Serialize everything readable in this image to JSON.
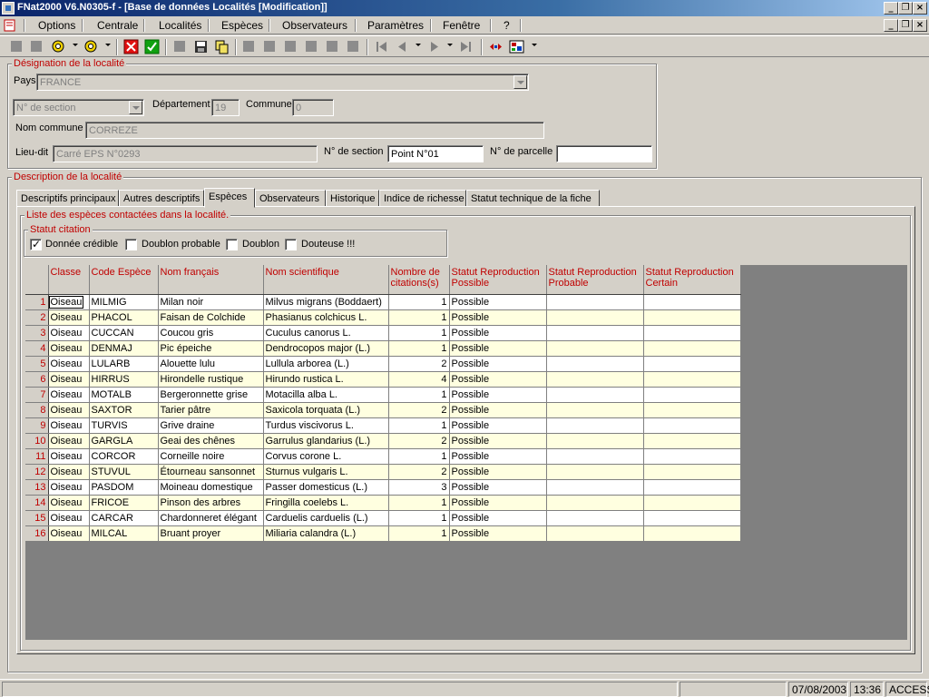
{
  "window": {
    "title": "FNat2000 V6.N0305-f - [Base de données Localités [Modification]]"
  },
  "menu": [
    "Options",
    "Centrale",
    "Localités",
    "Espèces",
    "Observateurs",
    "Paramètres",
    "Fenêtre",
    "?"
  ],
  "designation": {
    "title": "Désignation de la localité",
    "pays_label": "Pays",
    "pays_value": "FRANCE",
    "section_placeholder": "N° de section",
    "departement_label": "Département",
    "departement_value": "19",
    "commune_label": "Commune",
    "commune_value": "0",
    "nom_commune_label": "Nom commune",
    "nom_commune_value": "CORREZE",
    "lieudit_label": "Lieu-dit",
    "lieudit_value": "Carré EPS N°0293",
    "section_label": "N° de section",
    "section_value": "Point N°01",
    "parcelle_label": "N° de parcelle",
    "parcelle_value": ""
  },
  "description": {
    "title": "Description de la localité"
  },
  "tabs": [
    "Descriptifs principaux",
    "Autres descriptifs",
    "Espèces",
    "Observateurs",
    "Historique",
    "Indice de richesse",
    "Statut technique de la fiche"
  ],
  "active_tab": "Espèces",
  "species_group": {
    "title": "Liste des espèces contactées dans la localité."
  },
  "statut_citation": {
    "title": "Statut citation",
    "options": [
      {
        "label": "Donnée crédible",
        "checked": true
      },
      {
        "label": "Doublon probable",
        "checked": false
      },
      {
        "label": "Doublon",
        "checked": false
      },
      {
        "label": "Douteuse !!!",
        "checked": false
      }
    ]
  },
  "grid": {
    "columns": [
      "Classe",
      "Code Espèce",
      "Nom français",
      "Nom scientifique",
      "Nombre de citations(s)",
      "Statut Reproduction Possible",
      "Statut Reproduction Probable",
      "Statut Reproduction Certain"
    ],
    "rows": [
      [
        "1",
        "Oiseau",
        "MILMIG",
        "Milan noir",
        "Milvus migrans (Boddaert)",
        "1",
        "Possible",
        "",
        ""
      ],
      [
        "2",
        "Oiseau",
        "PHACOL",
        "Faisan de Colchide",
        "Phasianus colchicus L.",
        "1",
        "Possible",
        "",
        ""
      ],
      [
        "3",
        "Oiseau",
        "CUCCAN",
        "Coucou gris",
        "Cuculus canorus L.",
        "1",
        "Possible",
        "",
        ""
      ],
      [
        "4",
        "Oiseau",
        "DENMAJ",
        "Pic épeiche",
        "Dendrocopos major (L.)",
        "1",
        "Possible",
        "",
        ""
      ],
      [
        "5",
        "Oiseau",
        "LULARB",
        "Alouette lulu",
        "Lullula arborea (L.)",
        "2",
        "Possible",
        "",
        ""
      ],
      [
        "6",
        "Oiseau",
        "HIRRUS",
        "Hirondelle rustique",
        "Hirundo rustica L.",
        "4",
        "Possible",
        "",
        ""
      ],
      [
        "7",
        "Oiseau",
        "MOTALB",
        "Bergeronnette grise",
        "Motacilla alba L.",
        "1",
        "Possible",
        "",
        ""
      ],
      [
        "8",
        "Oiseau",
        "SAXTOR",
        "Tarier pâtre",
        "Saxicola torquata (L.)",
        "2",
        "Possible",
        "",
        ""
      ],
      [
        "9",
        "Oiseau",
        "TURVIS",
        "Grive draine",
        "Turdus viscivorus L.",
        "1",
        "Possible",
        "",
        ""
      ],
      [
        "10",
        "Oiseau",
        "GARGLA",
        "Geai des chênes",
        "Garrulus glandarius (L.)",
        "2",
        "Possible",
        "",
        ""
      ],
      [
        "11",
        "Oiseau",
        "CORCOR",
        "Corneille noire",
        "Corvus corone L.",
        "1",
        "Possible",
        "",
        ""
      ],
      [
        "12",
        "Oiseau",
        "STUVUL",
        "Étourneau sansonnet",
        "Sturnus vulgaris L.",
        "2",
        "Possible",
        "",
        ""
      ],
      [
        "13",
        "Oiseau",
        "PASDOM",
        "Moineau domestique",
        "Passer domesticus (L.)",
        "3",
        "Possible",
        "",
        ""
      ],
      [
        "14",
        "Oiseau",
        "FRICOE",
        "Pinson des arbres",
        "Fringilla coelebs L.",
        "1",
        "Possible",
        "",
        ""
      ],
      [
        "15",
        "Oiseau",
        "CARCAR",
        "Chardonneret élégant",
        "Carduelis carduelis (L.)",
        "1",
        "Possible",
        "",
        ""
      ],
      [
        "16",
        "Oiseau",
        "MILCAL",
        "Bruant proyer",
        "Miliaria calandra (L.)",
        "1",
        "Possible",
        "",
        ""
      ]
    ]
  },
  "status": {
    "date": "07/08/2003",
    "time": "13:36",
    "mode": "ACCESS"
  },
  "colors": {
    "label_red": "#c00000",
    "row_yellow": "#ffffe0",
    "face": "#d4d0c8"
  }
}
